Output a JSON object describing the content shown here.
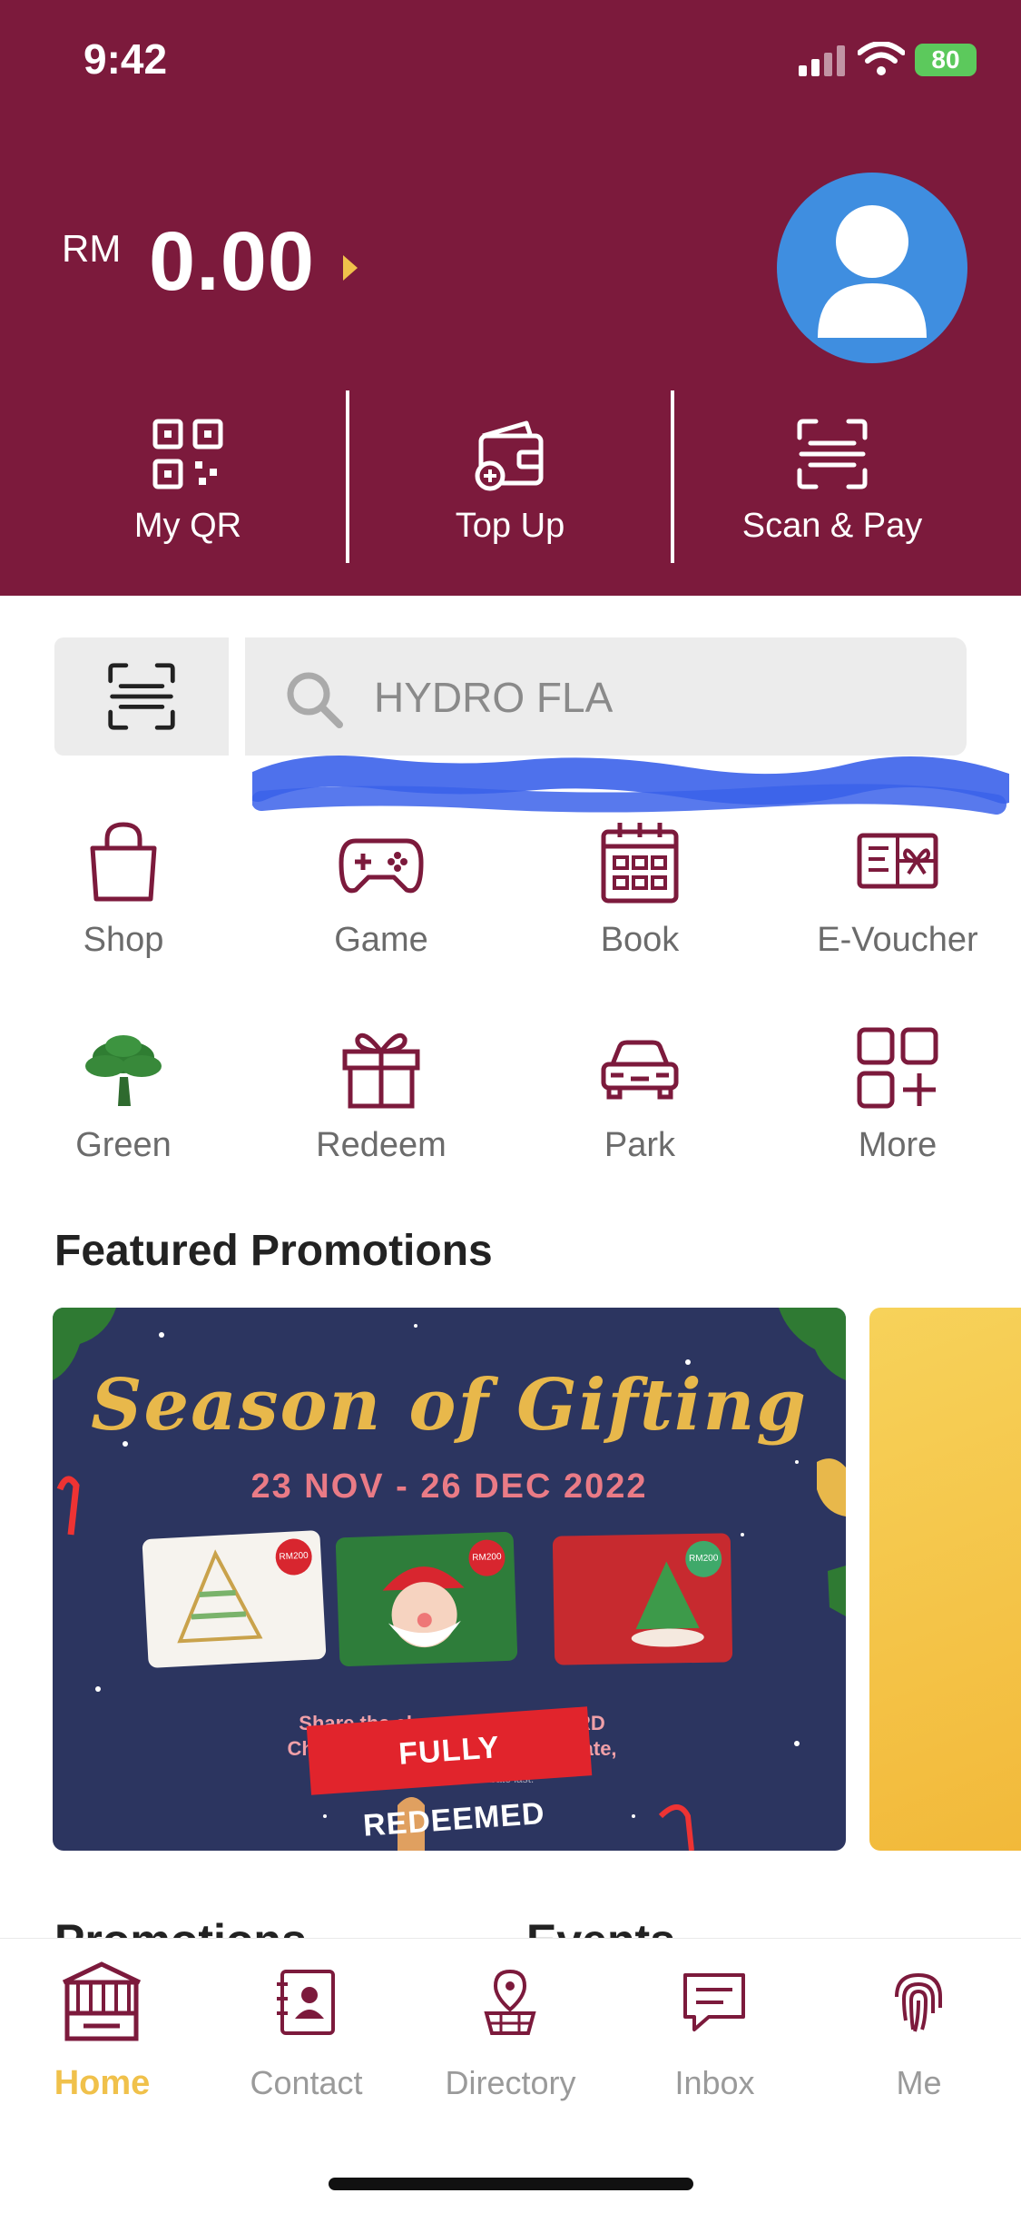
{
  "status": {
    "time": "9:42",
    "battery": "80"
  },
  "wallet": {
    "currency": "RM",
    "amount": "0.00"
  },
  "quick_actions": [
    {
      "label": "My QR",
      "icon": "qr-code-icon"
    },
    {
      "label": "Top Up",
      "icon": "wallet-add-icon"
    },
    {
      "label": "Scan & Pay",
      "icon": "scan-icon"
    }
  ],
  "search": {
    "value": "HYDRO FLA"
  },
  "categories": [
    {
      "label": "Shop",
      "icon": "shopping-bag-icon"
    },
    {
      "label": "Game",
      "icon": "gamepad-icon"
    },
    {
      "label": "Book",
      "icon": "calendar-icon"
    },
    {
      "label": "E-Voucher",
      "icon": "voucher-icon"
    },
    {
      "label": "Green",
      "icon": "tree-icon"
    },
    {
      "label": "Redeem",
      "icon": "gift-icon"
    },
    {
      "label": "Park",
      "icon": "car-icon"
    },
    {
      "label": "More",
      "icon": "more-grid-icon"
    }
  ],
  "featured": {
    "title": "Featured Promotions",
    "banner": {
      "headline": "Season of Gifting",
      "dates": "23 NOV - 26 DEC 2022",
      "stamp": "FULLY REDEEMED",
      "card_tag": "RM200",
      "line1": "Share the cheer ... lly ONECARD",
      "line2": "Christmas e-Gift ... D Cash Rebate,",
      "line3": "avai ... now!",
      "terms": "T&Cs apply, while cash rebate last."
    }
  },
  "sections_peek": {
    "left": "Promotions",
    "right": "Events"
  },
  "tabs": [
    {
      "label": "Home",
      "icon": "mall-icon",
      "active": true
    },
    {
      "label": "Contact",
      "icon": "contact-book-icon",
      "active": false
    },
    {
      "label": "Directory",
      "icon": "directory-pin-icon",
      "active": false
    },
    {
      "label": "Inbox",
      "icon": "chat-icon",
      "active": false
    },
    {
      "label": "Me",
      "icon": "fingerprint-icon",
      "active": false
    }
  ],
  "colors": {
    "brand": "#7c1a3c",
    "accent": "#f0c14b",
    "avatar": "#3f8ee0"
  }
}
